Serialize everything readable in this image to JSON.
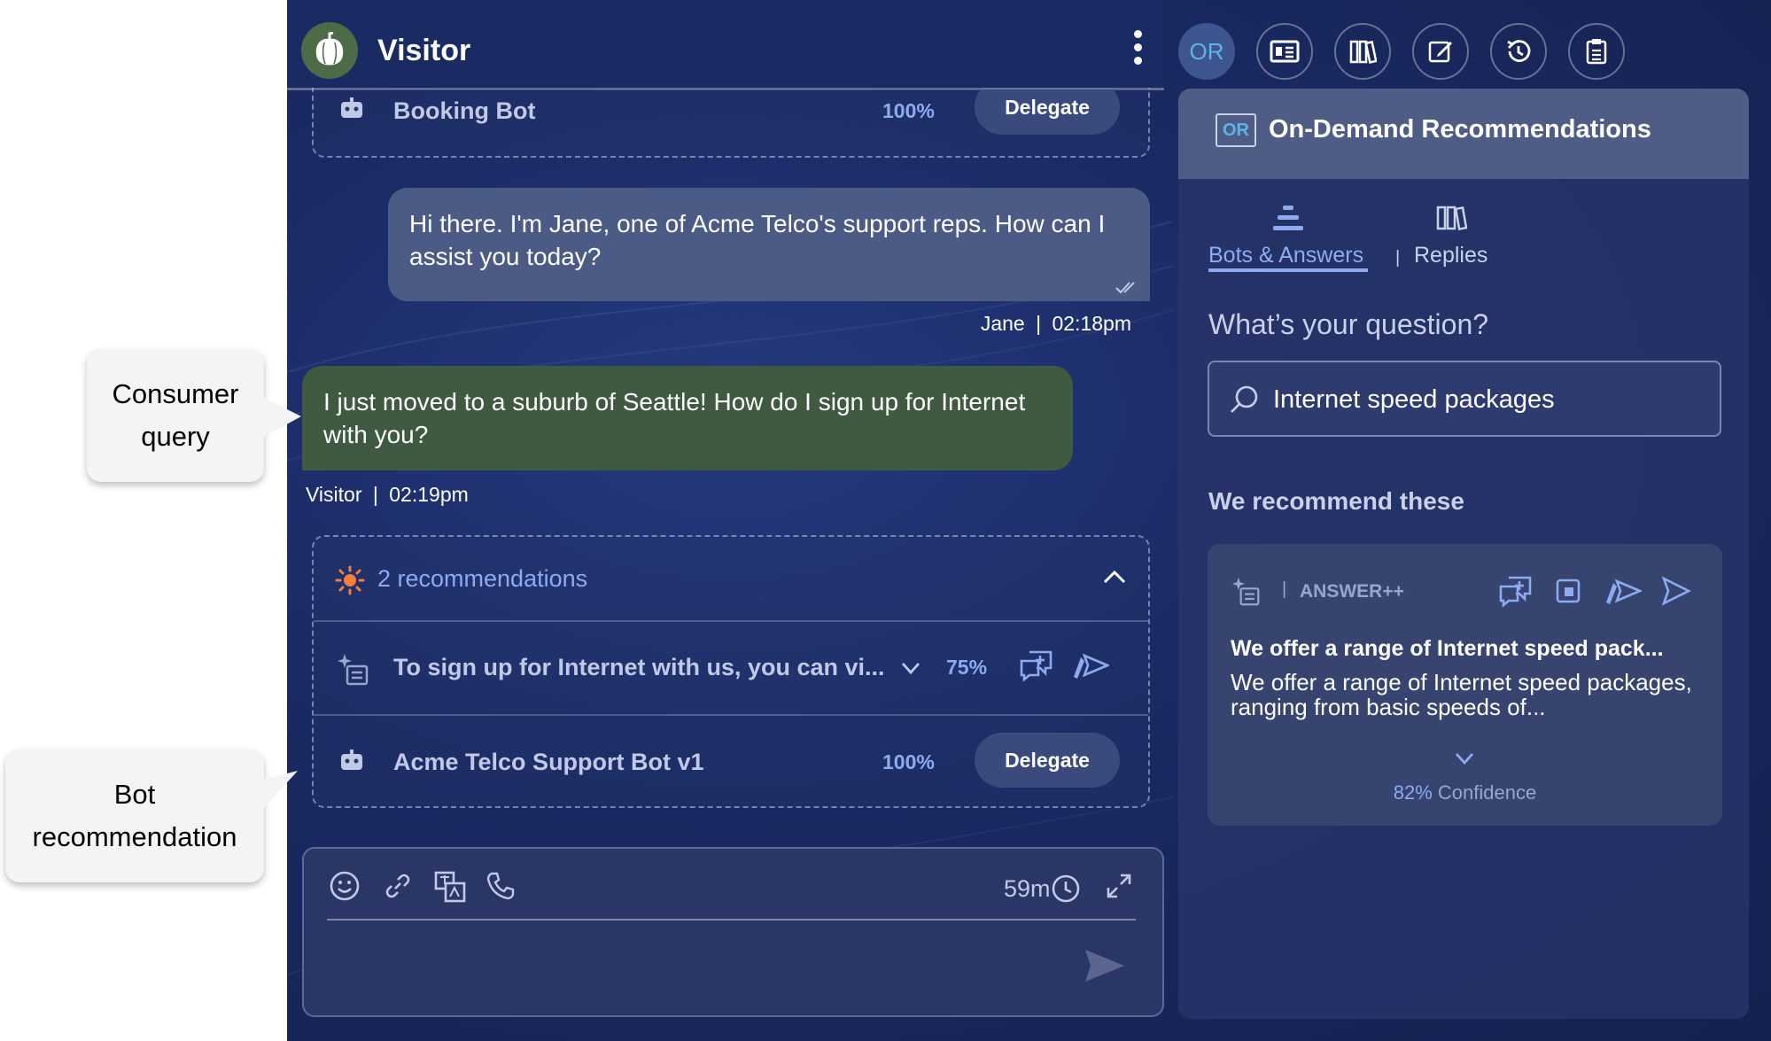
{
  "header": {
    "visitor_name": "Visitor",
    "toolbar": [
      {
        "name": "or-toolbar-button",
        "label": "OR",
        "icon": "or-icon"
      },
      {
        "name": "consumer-info-button",
        "icon": "id-card-icon"
      },
      {
        "name": "knowledge-base-button",
        "icon": "books-icon"
      },
      {
        "name": "notes-button",
        "icon": "edit-icon"
      },
      {
        "name": "history-button",
        "icon": "history-icon"
      },
      {
        "name": "clipboard-button",
        "icon": "clipboard-icon"
      }
    ]
  },
  "chat": {
    "top_bot": {
      "name": "Booking Bot",
      "confidence": "100%",
      "action": "Delegate"
    },
    "agent_message": {
      "text": "Hi there. I'm Jane, one of Acme Telco's support reps. How can I assist you today?",
      "author": "Jane",
      "time": "02:18pm"
    },
    "visitor_message": {
      "text": "I just moved to a suburb of Seattle! How do I sign up for Internet with you?",
      "author": "Visitor",
      "time": "02:19pm"
    },
    "recommendations": {
      "header": "2 recommendations",
      "answer": {
        "text": "To sign up for Internet with us, you can vi...",
        "confidence": "75%"
      },
      "bot": {
        "name": "Acme Telco Support Bot v1",
        "confidence": "100%",
        "action": "Delegate"
      }
    },
    "composer": {
      "timer": "59m"
    }
  },
  "panel": {
    "badge": "OR",
    "title": "On-Demand Recommendations",
    "tabs": [
      {
        "label": "Bots & Answers",
        "active": true
      },
      {
        "label": "Replies",
        "active": false
      }
    ],
    "question_label": "What’s your question?",
    "search_value": "Internet speed packages",
    "recommend_heading": "We recommend these",
    "card": {
      "type": "ANSWER++",
      "title": "We offer a range of Internet speed pack...",
      "body": "We offer a range of Internet speed packages, ranging from basic speeds of...",
      "confidence_value": "82%",
      "confidence_label": "Confidence"
    }
  },
  "callouts": {
    "consumer_query": "Consumer query",
    "bot_recommendation": "Bot recommendation"
  },
  "colors": {
    "background": "#1a2a63",
    "agent_bubble": "#4b5b85",
    "visitor_bubble": "#3f5a41",
    "accent": "#8eaaf0",
    "or_blue": "#5db4e6",
    "sun_orange": "#f0803c"
  }
}
